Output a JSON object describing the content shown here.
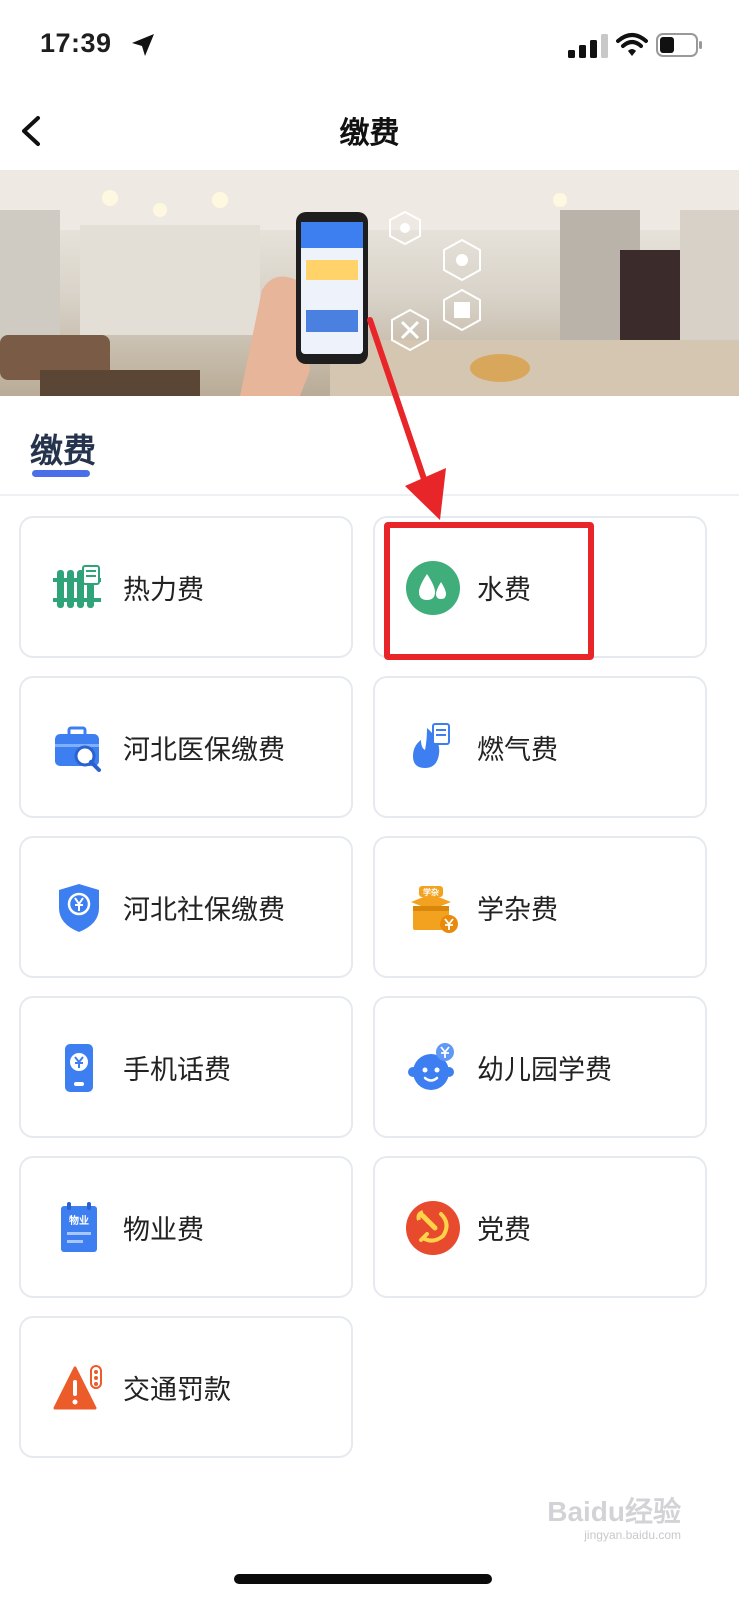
{
  "status_bar": {
    "time": "17:39"
  },
  "nav": {
    "title": "缴费"
  },
  "section": {
    "title": "缴费"
  },
  "tiles": [
    {
      "label": "热力费",
      "icon": "radiator-icon"
    },
    {
      "label": "水费",
      "icon": "water-drop-icon"
    },
    {
      "label": "河北医保缴费",
      "icon": "medical-briefcase-icon"
    },
    {
      "label": "燃气费",
      "icon": "gas-flame-icon"
    },
    {
      "label": "河北社保缴费",
      "icon": "shield-yuan-icon"
    },
    {
      "label": "学杂费",
      "icon": "graduation-box-icon"
    },
    {
      "label": "手机话费",
      "icon": "phone-yuan-icon"
    },
    {
      "label": "幼儿园学费",
      "icon": "baby-face-icon"
    },
    {
      "label": "物业费",
      "icon": "property-notebook-icon"
    },
    {
      "label": "党费",
      "icon": "party-emblem-icon"
    },
    {
      "label": "交通罚款",
      "icon": "traffic-warning-icon"
    }
  ],
  "icon_texts": {
    "property": "物业",
    "school": "学杂"
  },
  "watermark": {
    "brand": "Baidu经验",
    "url": "jingyan.baidu.com"
  },
  "colors": {
    "accent": "#4a6fe8",
    "annotation": "#e8262a",
    "water": "#3fae7a",
    "heating": "#2fa37a",
    "blue_icon": "#3d7ff0",
    "gas": "#3d7ff0",
    "school": "#f3a21f",
    "party": "#e84a2e",
    "warning": "#ec5b2a"
  }
}
